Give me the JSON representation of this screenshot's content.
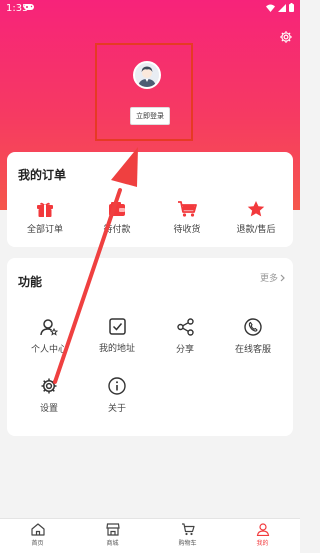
{
  "status": {
    "time": "1:35"
  },
  "profile": {
    "login_label": "立即登录"
  },
  "orders": {
    "title": "我的订单",
    "items": [
      {
        "label": "全部订单",
        "icon": "gift-icon"
      },
      {
        "label": "待付款",
        "icon": "wallet-icon"
      },
      {
        "label": "待收货",
        "icon": "cart-icon"
      },
      {
        "label": "退款/售后",
        "icon": "star-icon"
      }
    ]
  },
  "functions": {
    "title": "功能",
    "more_label": "更多",
    "items": [
      {
        "label": "个人中心",
        "icon": "user-icon"
      },
      {
        "label": "我的地址",
        "icon": "checkbox-icon"
      },
      {
        "label": "分享",
        "icon": "share-icon"
      },
      {
        "label": "在线客服",
        "icon": "phone-icon"
      },
      {
        "label": "设置",
        "icon": "gear-icon"
      },
      {
        "label": "关于",
        "icon": "info-icon"
      }
    ]
  },
  "tabbar": {
    "items": [
      {
        "label": "首页",
        "icon": "home-icon"
      },
      {
        "label": "商城",
        "icon": "store-icon"
      },
      {
        "label": "购物车",
        "icon": "cart-icon"
      },
      {
        "label": "我的",
        "icon": "person-icon"
      }
    ],
    "active_index": 3
  },
  "colors": {
    "accent": "#f2393c",
    "header_top": "#f7237a",
    "header_bottom": "#f5574b",
    "annotation": "#e63a24"
  }
}
